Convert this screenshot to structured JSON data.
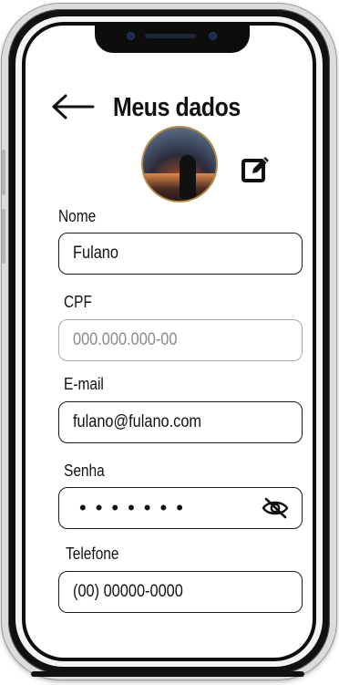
{
  "header": {
    "title": "Meus dados"
  },
  "icons": {
    "back": "arrow-left-icon",
    "edit": "edit-square-icon",
    "password_toggle": "eye-off-icon"
  },
  "form": {
    "nome": {
      "label": "Nome",
      "value": "Fulano"
    },
    "cpf": {
      "label": "CPF",
      "placeholder": "000.000.000-00"
    },
    "email": {
      "label": "E-mail",
      "value": "fulano@fulano.com"
    },
    "senha": {
      "label": "Senha",
      "value": "•••••••"
    },
    "telefone": {
      "label": "Telefone",
      "value": "(00) 00000-0000"
    }
  }
}
